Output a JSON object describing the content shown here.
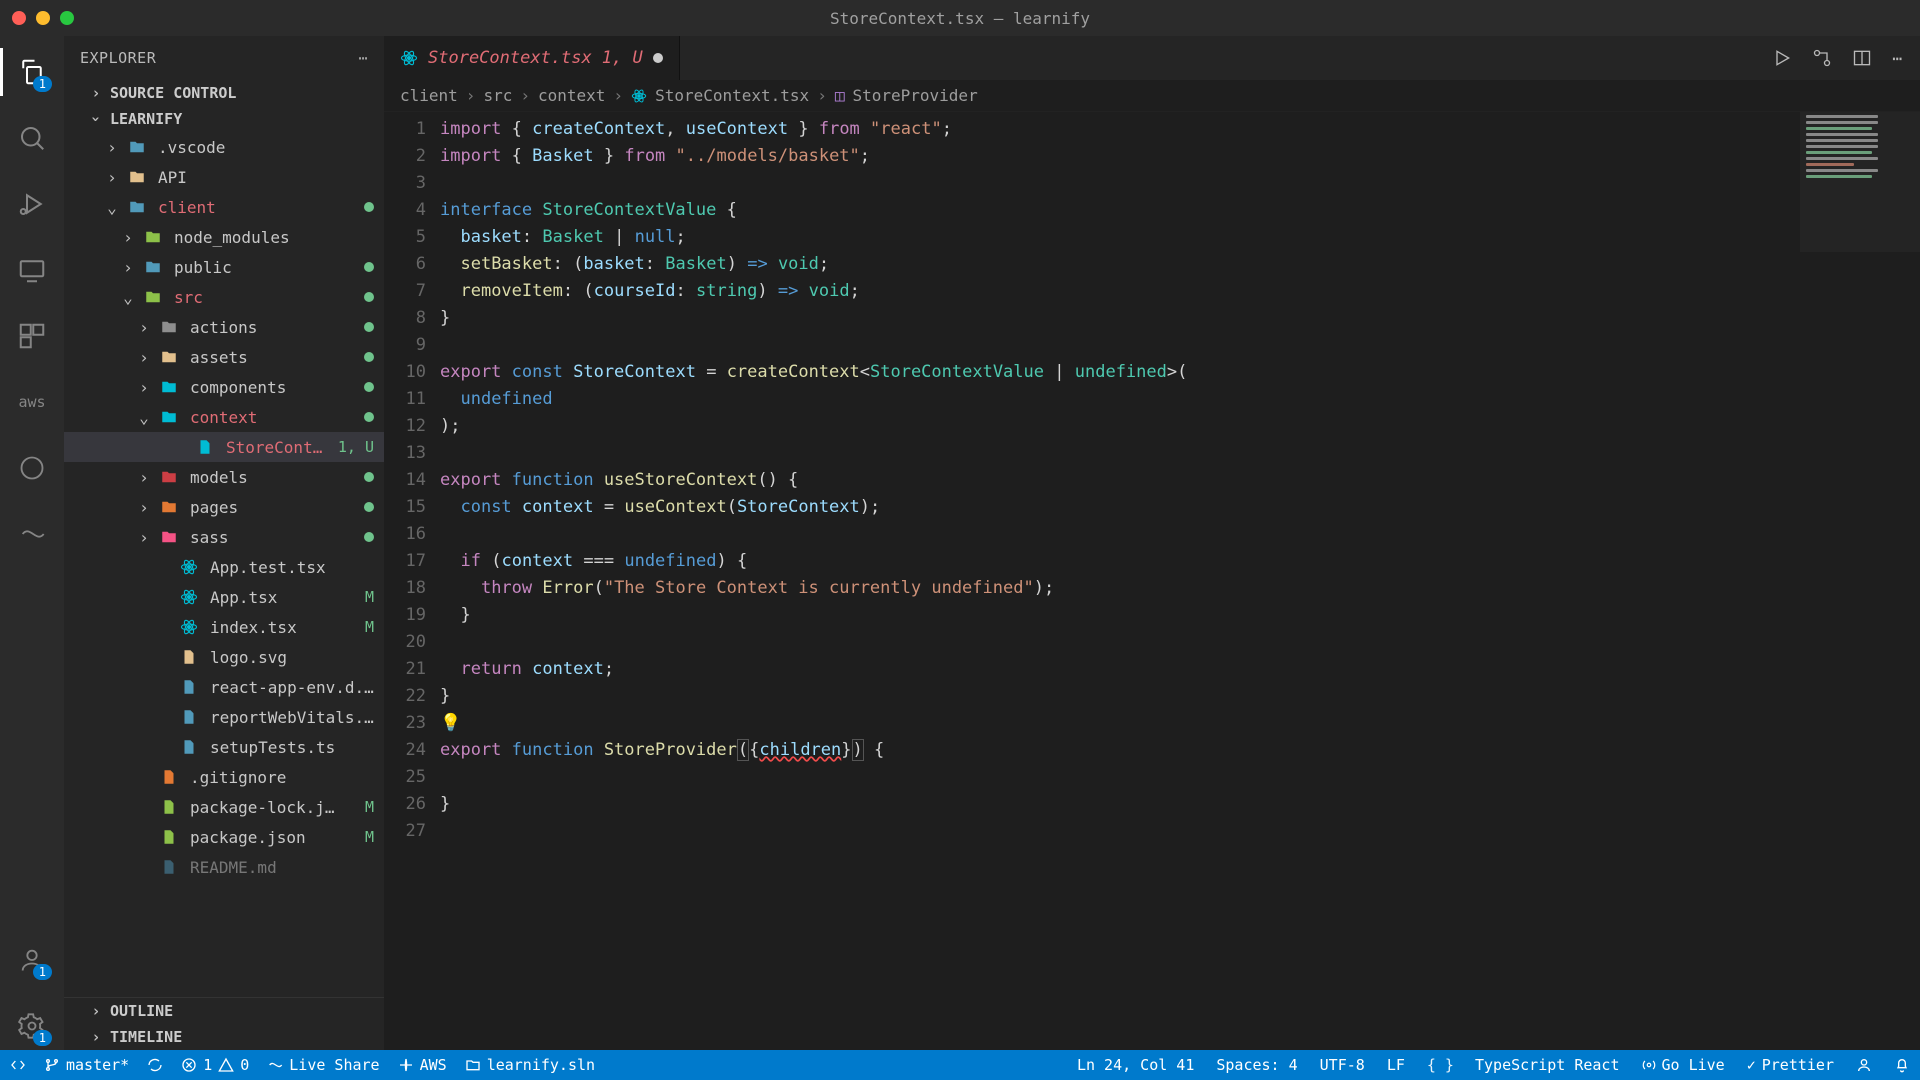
{
  "window": {
    "title": "StoreContext.tsx — learnify"
  },
  "sidebar": {
    "header": "EXPLORER",
    "sections": {
      "source_control": "SOURCE CONTROL",
      "project": "LEARNIFY",
      "outline": "OUTLINE",
      "timeline": "TIMELINE"
    },
    "tree": [
      {
        "name": ".vscode",
        "depth": 2,
        "chev": ">",
        "type": "folder",
        "color": "icon-blue"
      },
      {
        "name": "API",
        "depth": 2,
        "chev": ">",
        "type": "folder",
        "color": "icon-yellow"
      },
      {
        "name": "client",
        "depth": 2,
        "chev": "v",
        "type": "folder",
        "color": "icon-blue",
        "redName": true,
        "dot": true
      },
      {
        "name": "node_modules",
        "depth": 3,
        "chev": ">",
        "type": "folder",
        "color": "icon-green"
      },
      {
        "name": "public",
        "depth": 3,
        "chev": ">",
        "type": "folder",
        "color": "icon-blue",
        "dot": true
      },
      {
        "name": "src",
        "depth": 3,
        "chev": "v",
        "type": "folder",
        "color": "icon-green",
        "redName": true,
        "dot": true
      },
      {
        "name": "actions",
        "depth": 4,
        "chev": ">",
        "type": "folder",
        "color": "icon-gray",
        "dot": true
      },
      {
        "name": "assets",
        "depth": 4,
        "chev": ">",
        "type": "folder",
        "color": "icon-yellow",
        "dot": true
      },
      {
        "name": "components",
        "depth": 4,
        "chev": ">",
        "type": "folder",
        "color": "icon-cyan",
        "dot": true
      },
      {
        "name": "context",
        "depth": 4,
        "chev": "v",
        "type": "folder",
        "color": "icon-cyan",
        "redName": true,
        "dot": true
      },
      {
        "name": "StoreConte…",
        "depth": 6,
        "type": "file",
        "color": "icon-cyan",
        "redName": true,
        "tag": "1, U",
        "active": true
      },
      {
        "name": "models",
        "depth": 4,
        "chev": ">",
        "type": "folder",
        "color": "icon-red",
        "dot": true
      },
      {
        "name": "pages",
        "depth": 4,
        "chev": ">",
        "type": "folder",
        "color": "icon-orange",
        "dot": true
      },
      {
        "name": "sass",
        "depth": 4,
        "chev": ">",
        "type": "folder",
        "color": "icon-pink",
        "dot": true
      },
      {
        "name": "App.test.tsx",
        "depth": 5,
        "type": "file",
        "color": "icon-cyan"
      },
      {
        "name": "App.tsx",
        "depth": 5,
        "type": "file",
        "color": "icon-cyan",
        "tag": "M"
      },
      {
        "name": "index.tsx",
        "depth": 5,
        "type": "file",
        "color": "icon-cyan",
        "tag": "M"
      },
      {
        "name": "logo.svg",
        "depth": 5,
        "type": "file",
        "color": "icon-yellow"
      },
      {
        "name": "react-app-env.d.ts",
        "depth": 5,
        "type": "file",
        "color": "icon-blue"
      },
      {
        "name": "reportWebVitals.ts",
        "depth": 5,
        "type": "file",
        "color": "icon-blue"
      },
      {
        "name": "setupTests.ts",
        "depth": 5,
        "type": "file",
        "color": "icon-blue"
      },
      {
        "name": ".gitignore",
        "depth": 4,
        "type": "file",
        "color": "icon-orange"
      },
      {
        "name": "package-lock.j…",
        "depth": 4,
        "type": "file",
        "color": "icon-green",
        "tag": "M"
      },
      {
        "name": "package.json",
        "depth": 4,
        "type": "file",
        "color": "icon-green",
        "tag": "M"
      },
      {
        "name": "README.md",
        "depth": 4,
        "type": "file",
        "color": "icon-blue",
        "faded": true
      }
    ]
  },
  "tab": {
    "label": "StoreContext.tsx",
    "status": "1, U"
  },
  "breadcrumbs": [
    "client",
    "src",
    "context",
    "StoreContext.tsx",
    "StoreProvider"
  ],
  "code": {
    "lines": 27
  },
  "statusbar": {
    "branch": "master*",
    "errors": "1",
    "warnings": "0",
    "liveshare": "Live Share",
    "aws": "AWS",
    "solution": "learnify.sln",
    "position": "Ln 24, Col 41",
    "spaces": "Spaces: 4",
    "encoding": "UTF-8",
    "eol": "LF",
    "lang": "TypeScript React",
    "golive": "Go Live",
    "formatter": "Prettier"
  },
  "activity_badges": {
    "explorer": "1",
    "accounts": "1",
    "settings": "1"
  }
}
